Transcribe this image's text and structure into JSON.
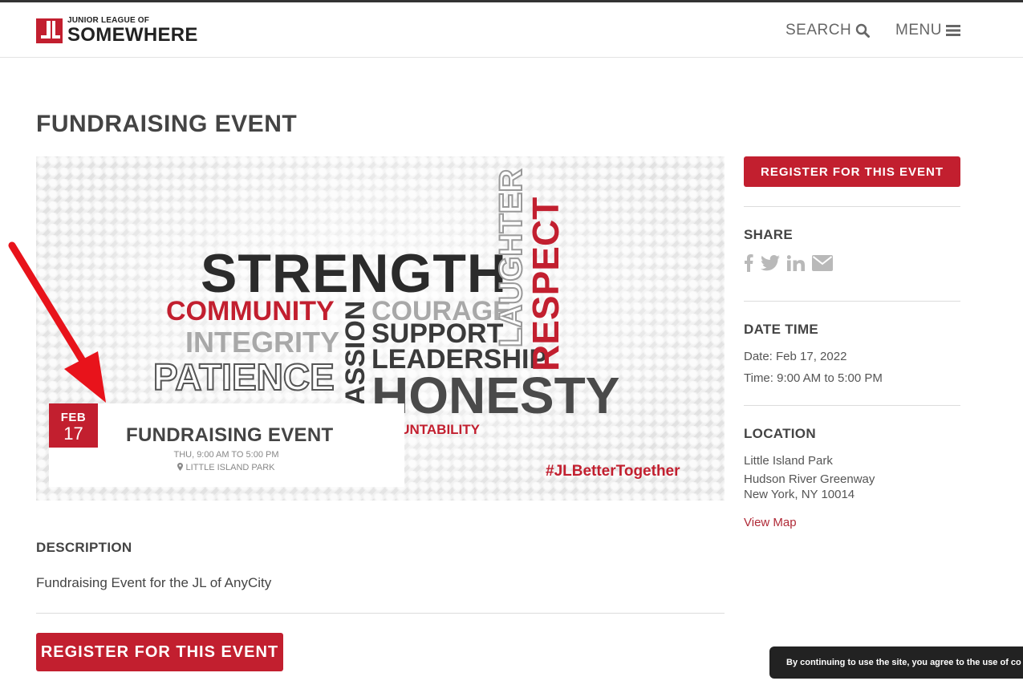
{
  "header": {
    "logo_small": "JUNIOR LEAGUE OF",
    "logo_big": "SOMEWHERE",
    "search_label": "SEARCH",
    "menu_label": "MENU"
  },
  "page": {
    "title": "FUNDRAISING EVENT"
  },
  "hero": {
    "words": {
      "strength": "STRENGTH",
      "community": "COMMUNITY",
      "courage": "COURAGE",
      "integrity": "INTEGRITY",
      "support": "SUPPORT",
      "leadership": "LEADERSHIP",
      "patience": "PATIENCE",
      "passion": "ASSION",
      "honesty": "HONESTY",
      "accountability": "OUNTABILITY",
      "laughter": "LAUGHTER",
      "respect": "RESPECT"
    },
    "hashtag": "#JLBetterTogether",
    "card": {
      "month": "FEB",
      "day": "17",
      "title": "FUNDRAISING EVENT",
      "time": "THU, 9:00 AM TO 5:00 PM",
      "place": "LITTLE ISLAND PARK"
    }
  },
  "description": {
    "heading": "DESCRIPTION",
    "text": "Fundraising Event for the JL of AnyCity"
  },
  "register_label": "REGISTER FOR THIS EVENT",
  "sidebar": {
    "share_heading": "SHARE",
    "share_icons": [
      "facebook-icon",
      "twitter-icon",
      "linkedin-icon",
      "email-icon"
    ],
    "datetime_heading": "DATE TIME",
    "date_line": "Date: Feb 17, 2022",
    "time_line": "Time: 9:00 AM to 5:00 PM",
    "location_heading": "LOCATION",
    "location_name": "Little Island Park",
    "location_street": "Hudson River Greenway",
    "location_city": "New York, NY 10014",
    "view_map": "View Map"
  },
  "cookie": {
    "text": "By continuing to use the site, you agree to the use of co"
  },
  "colors": {
    "accent": "#c21f2f",
    "text": "#444444",
    "muted": "#888888"
  }
}
